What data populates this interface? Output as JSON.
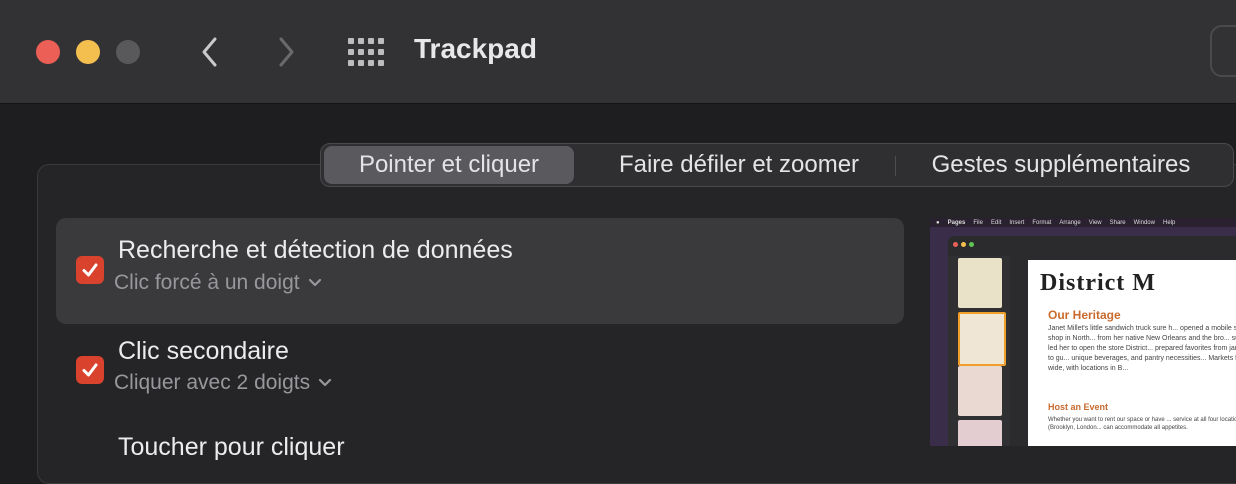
{
  "window": {
    "title": "Trackpad"
  },
  "tabs": [
    {
      "label": "Pointer et cliquer",
      "selected": true
    },
    {
      "label": "Faire défiler et zoomer",
      "selected": false
    },
    {
      "label": "Gestes supplémentaires",
      "selected": false
    }
  ],
  "options": [
    {
      "title": "Recherche et détection de données",
      "subtitle": "Clic forcé à un doigt",
      "checked": true
    },
    {
      "title": "Clic secondaire",
      "subtitle": "Cliquer avec 2 doigts",
      "checked": true
    },
    {
      "title": "Toucher pour cliquer",
      "checked": false
    }
  ],
  "preview": {
    "menubar": [
      "Pages",
      "File",
      "Edit",
      "Insert",
      "Format",
      "Arrange",
      "View",
      "Share",
      "Window",
      "Help"
    ],
    "doc_title": "District M",
    "heading": "Our Heritage",
    "body": "Janet Millet's little sandwich truck sure h... opened a mobile sandwich shop in North... from her native New Orleans and the bro... success led her to open the store District... prepared favorites from jambalaya to gu... unique beverages, and pantry necessities... Markets far and wide, with locations in B...",
    "heading2": "Host an Event",
    "body2": "Whether you want to rent our space or have ... service at all four locations (Brooklyn, London... can accommodate all appetites."
  },
  "colors": {
    "checkbox": "#d9432e",
    "title_bar": "#323235",
    "panel": "#252527"
  }
}
